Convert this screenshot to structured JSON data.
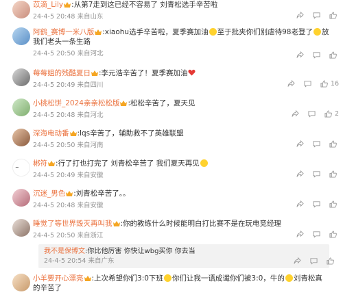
{
  "colors": {
    "username": "#eb7340",
    "meta": "#939393",
    "text": "#333333"
  },
  "comments": [
    {
      "username": "苡滴_Lily",
      "badge": "crown-vip-icon",
      "text": ":从第7走到这已经不容易了 刘青松选手辛苦啦",
      "date": "24-4-5 20:48",
      "location": "来自山东",
      "likes": ""
    },
    {
      "username": "阿鹤_赛博一米八版",
      "badge": "crown-vip-icon",
      "text": ":xiaohu选手辛苦啦，夏季赛加油",
      "text2": "至于批夹你们别虐待98老登了",
      "text3": "放我们老头一条生路",
      "date": "24-4-5 20:50",
      "location": "来自河北",
      "likes": ""
    },
    {
      "username": "莓莓姐的残酷夏日",
      "badge": "crown-vip-icon",
      "text": ":李元浩辛苦了！夏季赛加油",
      "date": "24-4-5 20:49",
      "location": "来自四川",
      "likes": "16"
    },
    {
      "username": "小桃松饼_2024亲亲松松版",
      "badge": "crown-vip-icon",
      "text": ":松松辛苦了，夏天见",
      "date": "24-4-5 20:48",
      "location": "来自河北",
      "likes": "2"
    },
    {
      "username": "深海电动番",
      "badge": "crown-vip-icon",
      "text": ":lqs辛苦了，辅助救不了英雄联盟",
      "date": "24-4-5 20:50",
      "location": "来自河南",
      "likes": ""
    },
    {
      "username": "郴符",
      "badge": "crown-vip-icon",
      "text": ":行了打也打完了 刘青松辛苦了 我们夏天再见",
      "date": "24-4-5 20:49",
      "location": "来自安徽",
      "likes": ""
    },
    {
      "username": "沉迷_男色",
      "badge": "crown-vip-icon",
      "text": ":刘青松辛苦了。。",
      "date": "24-4-5 20:48",
      "location": "来自安徽",
      "likes": ""
    },
    {
      "username": "睡觉了等世界毁灭再叫我",
      "badge": "crown-vip-icon",
      "text": ":你的教练什么时候能明白打比赛不是在玩电竞经理",
      "date": "24-4-5 20:50",
      "location": "来自浙江",
      "likes": "",
      "reply": {
        "username": "我不是保博文",
        "text": ":你比他厉害 你快让wbg买你 你去当",
        "date": "24-4-5 20:54",
        "location": "来自广东"
      }
    },
    {
      "username": "小羊要开心漂亮",
      "badge": "crown-vip-icon",
      "text": ":上次希望你们3:0下班",
      "text2": "你们让我一语成谶你们被3:0，牛的",
      "text3": "刘青松真的辛苦了",
      "date": "",
      "location": "",
      "likes": ""
    }
  ]
}
